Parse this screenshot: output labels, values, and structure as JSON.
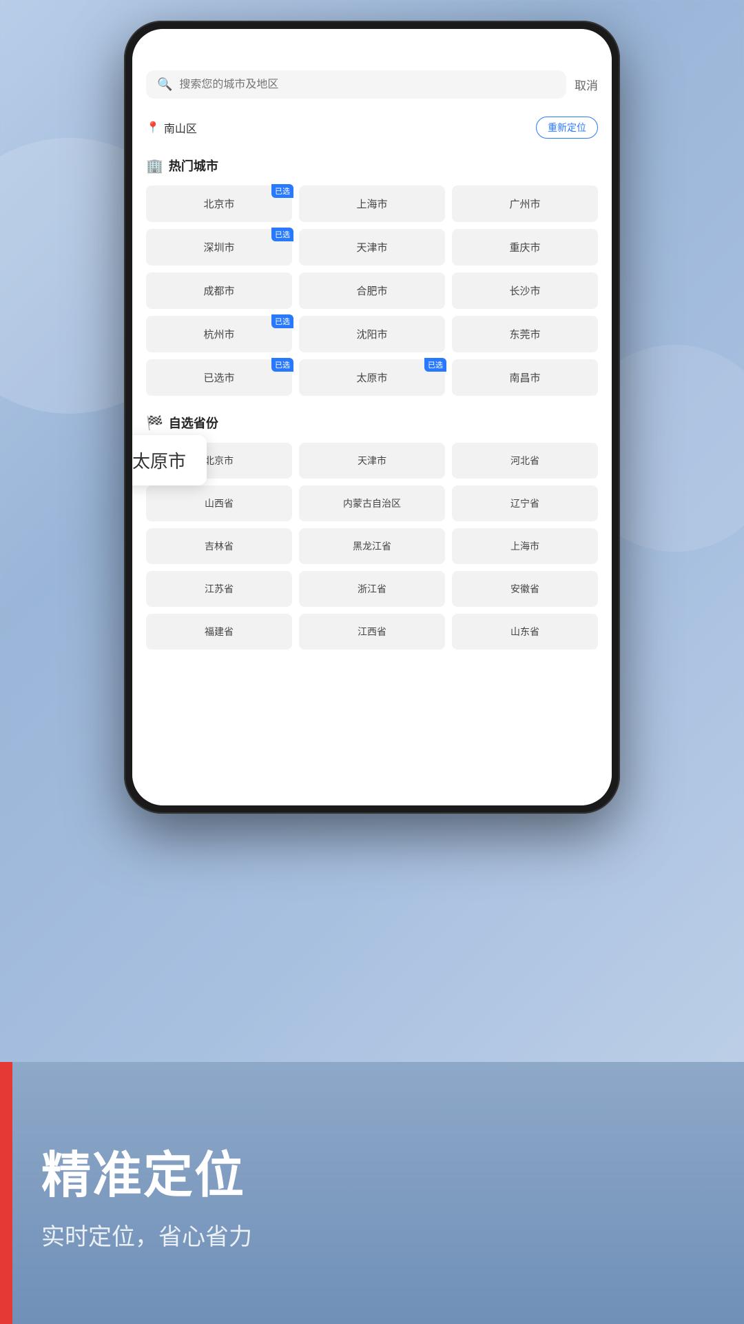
{
  "search": {
    "placeholder": "搜索您的城市及地区",
    "cancel_label": "取消"
  },
  "location": {
    "current": "南山区",
    "relocate_label": "重新定位"
  },
  "hot_cities": {
    "section_title": "热门城市",
    "cities": [
      {
        "name": "北京市",
        "selected": true
      },
      {
        "name": "上海市",
        "selected": false
      },
      {
        "name": "广州市",
        "selected": false
      },
      {
        "name": "深圳市",
        "selected": true
      },
      {
        "name": "天津市",
        "selected": false
      },
      {
        "name": "重庆市",
        "selected": false
      },
      {
        "name": "成都市",
        "selected": false
      },
      {
        "name": "合肥市",
        "selected": false
      },
      {
        "name": "长沙市",
        "selected": false
      },
      {
        "name": "杭州市",
        "selected": true
      },
      {
        "name": "沈阳市",
        "selected": false
      },
      {
        "name": "东莞市",
        "selected": false
      },
      {
        "name": "已选市",
        "selected": true
      },
      {
        "name": "太原市",
        "selected": true
      },
      {
        "name": "南昌市",
        "selected": false
      }
    ]
  },
  "tooltip": {
    "text": "太原市"
  },
  "province": {
    "section_title": "自选省份",
    "provinces": [
      {
        "name": "北京市"
      },
      {
        "name": "天津市"
      },
      {
        "name": "河北省"
      },
      {
        "name": "山西省"
      },
      {
        "name": "内蒙古自治区"
      },
      {
        "name": "辽宁省"
      },
      {
        "name": "吉林省"
      },
      {
        "name": "黑龙江省"
      },
      {
        "name": "上海市"
      },
      {
        "name": "江苏省"
      },
      {
        "name": "浙江省"
      },
      {
        "name": "安徽省"
      },
      {
        "name": "福建省"
      },
      {
        "name": "江西省"
      },
      {
        "name": "山东省"
      }
    ]
  },
  "marketing": {
    "title": "精准定位",
    "subtitle": "实时定位，省心省力"
  },
  "icons": {
    "search": "🔍",
    "location_pin": "📍",
    "hot_city": "🏢",
    "province": "🏁"
  }
}
